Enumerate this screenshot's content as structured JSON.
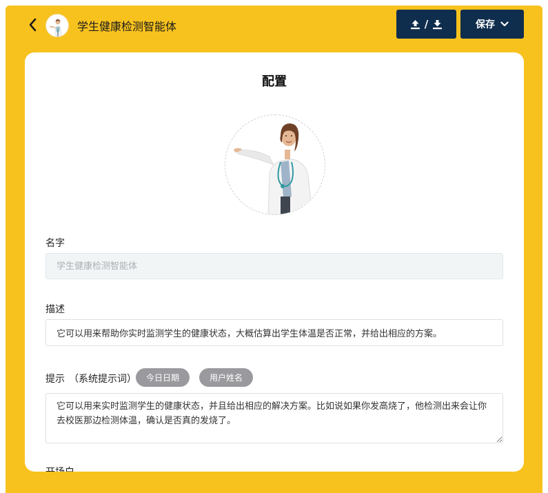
{
  "header": {
    "title": "学生健康检测智能体",
    "io_separator": "/",
    "save_label": "保存"
  },
  "card": {
    "title": "配置",
    "name": {
      "label": "名字",
      "placeholder": "学生健康检测智能体"
    },
    "description": {
      "label": "描述",
      "value": "它可以用来帮助你实时监测学生的健康状态，大概估算出学生体温是否正常，并给出相应的方案。"
    },
    "prompt": {
      "label": "提示",
      "hint": "（系统提示词）",
      "chips": [
        "今日日期",
        "用户姓名"
      ],
      "value": "它可以用来实时监测学生的健康状态，并且给出相应的解决方案。比如说如果你发高烧了，他检测出来会让你去校医那边检测体温，确认是否真的发烧了。"
    },
    "opening": {
      "label": "开场白"
    }
  },
  "colors": {
    "frame": "#F8C21E",
    "button": "#0F2D4D",
    "chip": "#9A9A9E"
  },
  "icons": [
    "chevron-left-icon",
    "upload-icon",
    "download-icon",
    "chevron-down-icon"
  ]
}
